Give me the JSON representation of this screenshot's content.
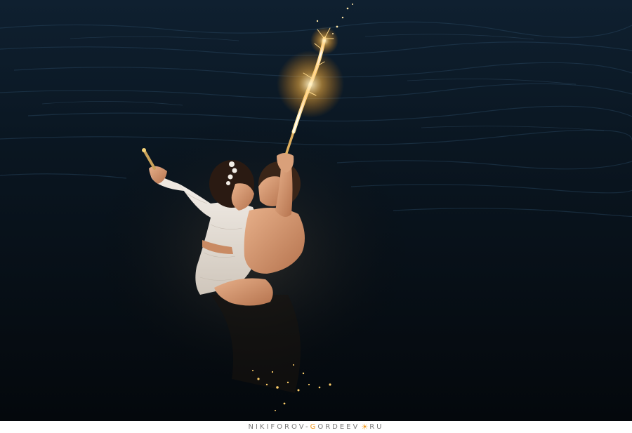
{
  "photo": {
    "alt_semantic": "night-water-couple-sparklers-photo"
  },
  "watermark": {
    "part1": "NIKIFOROV-",
    "accent_letter": "G",
    "part2": "ORDEEV",
    "sun_glyph": "☀",
    "part3": "RU"
  },
  "colors": {
    "water_dark": "#050b10",
    "sparkler_glow": "#ffd27a",
    "accent": "#f29a1f"
  }
}
